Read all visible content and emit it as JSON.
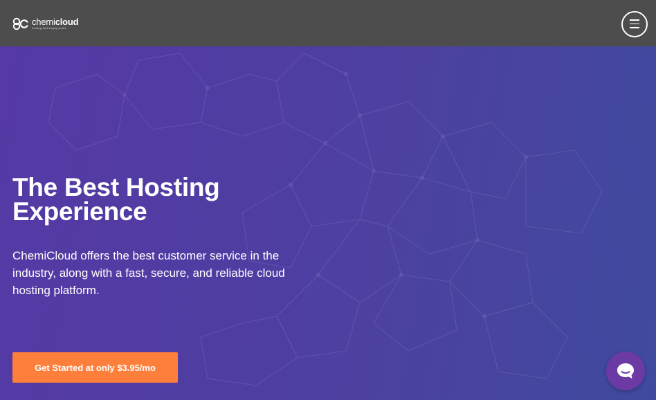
{
  "header": {
    "logo": {
      "name_light": "chemi",
      "name_bold": "cloud",
      "tagline": "hosting that simply works",
      "icon": "chemicloud-logo-icon"
    },
    "menu_icon": "hamburger-menu-icon"
  },
  "hero": {
    "title": "The Best Hosting Experience",
    "subtitle": "ChemiCloud offers the best customer service in the industry, along with a fast, secure, and reliable cloud hosting platform.",
    "cta_label": "Get Started at only $3.95/mo"
  },
  "chat": {
    "icon": "chat-bubble-icon"
  },
  "colors": {
    "header_bg": "#4d4d4d",
    "hero_gradient_start": "#5539a4",
    "hero_gradient_end": "#3f4a9e",
    "cta_bg": "#fd7f3b",
    "chat_bg": "#6c3aa4",
    "text": "#ffffff"
  }
}
